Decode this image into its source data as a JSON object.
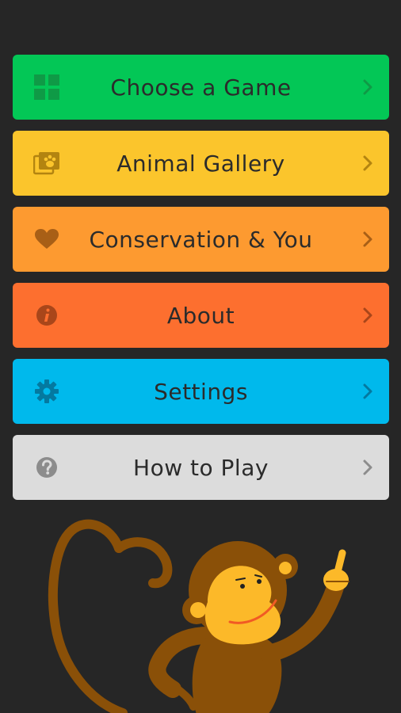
{
  "menu": {
    "items": [
      {
        "label": "Choose a Game",
        "color": "#03c756",
        "icon": "grid-icon"
      },
      {
        "label": "Animal Gallery",
        "color": "#fbc52c",
        "icon": "photo-gallery-icon"
      },
      {
        "label": "Conservation & You",
        "color": "#fd9a30",
        "icon": "heart-icon"
      },
      {
        "label": "About",
        "color": "#fd6f2f",
        "icon": "info-icon"
      },
      {
        "label": "Settings",
        "color": "#00b9ec",
        "icon": "gear-icon"
      },
      {
        "label": "How to Play",
        "color": "#dcdcdc",
        "icon": "help-icon"
      }
    ]
  },
  "colors": {
    "background": "#262626",
    "monkey_fur": "#8a5008",
    "monkey_face": "#fcb929",
    "monkey_smile": "#f15a24"
  },
  "illustration": "monkey-mascot"
}
